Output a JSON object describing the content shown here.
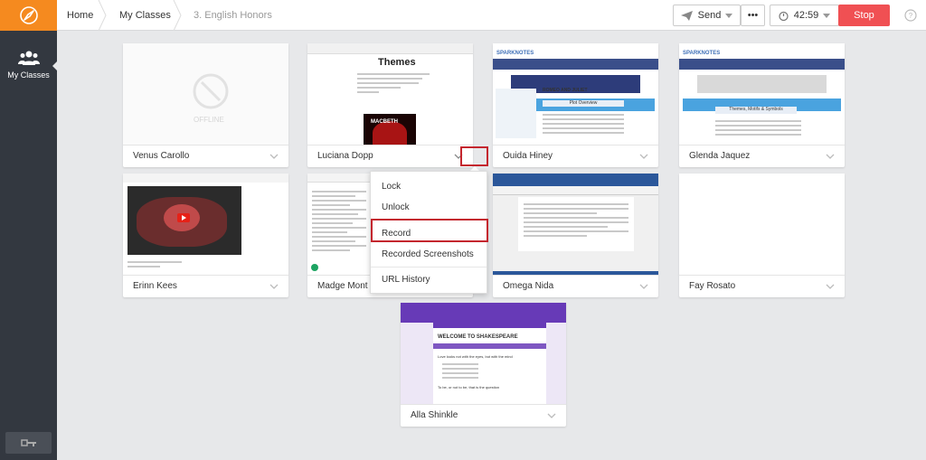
{
  "sidebar": {
    "nav_label": "My Classes"
  },
  "breadcrumb": {
    "home": "Home",
    "classes": "My Classes",
    "current": "3. English Honors"
  },
  "toolbar": {
    "send_label": "Send",
    "more_label": "•••",
    "timer": "42:59",
    "stop_label": "Stop"
  },
  "offline_label": "OFFLINE",
  "students": [
    {
      "name": "Venus Carollo"
    },
    {
      "name": "Luciana Dopp"
    },
    {
      "name": "Ouida Hiney"
    },
    {
      "name": "Glenda Jaquez"
    },
    {
      "name": "Erinn Kees"
    },
    {
      "name": "Madge Mont"
    },
    {
      "name": "Omega Nida"
    },
    {
      "name": "Fay Rosato"
    },
    {
      "name": "Alla Shinkle"
    }
  ],
  "thumbs": {
    "doc_title": "Themes",
    "macbeth": "MACBETH",
    "sn_brand": "SPARKNOTES",
    "romeo_juliet": "ROMEO AND JULIET",
    "plot_overview": "Plot Overview",
    "themes_heading": "Themes, Motifs & Symbols",
    "form_title": "WELCOME TO SHAKESPEARE",
    "form_q1": "Love looks not with the eyes, but with the mind",
    "form_q2": "To be, or not to be, that is the question"
  },
  "menu": {
    "items": [
      "Lock",
      "Unlock",
      "Record",
      "Recorded Screenshots",
      "URL History"
    ]
  },
  "colors": {
    "accent": "#f58a1f",
    "sidebar": "#333840",
    "stop": "#f05053",
    "highlight": "#c4262e",
    "form_purple": "#673ab7"
  }
}
